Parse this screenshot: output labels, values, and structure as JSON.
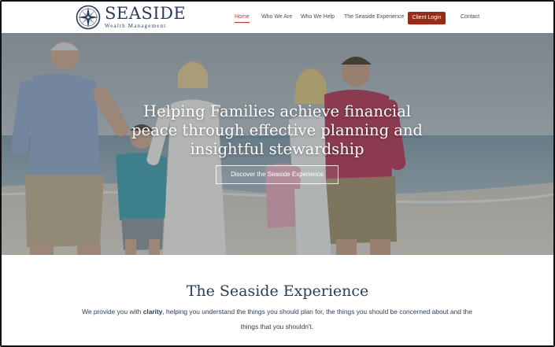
{
  "brand": {
    "name": "SEASIDE",
    "tagline": "Wealth Management",
    "logo_icon": "compass-rose-icon"
  },
  "nav": {
    "items": [
      {
        "label": "Home",
        "active": true
      },
      {
        "label": "Who We Are",
        "active": false
      },
      {
        "label": "Who We Help",
        "active": false
      },
      {
        "label": "The Seaside Experience",
        "active": false
      }
    ],
    "login_label": "Client Login",
    "contact_label": "Contact"
  },
  "hero": {
    "headline_line1": "Helping Families achieve financial",
    "headline_line2": "peace through effective planning and",
    "headline_line3": "insightful stewardship",
    "cta_label": "Discover the Seaside Experience"
  },
  "section": {
    "title": "The Seaside Experience",
    "body_pre": "We provide you with ",
    "body_bold": "clarity",
    "body_post": ", helping you understand the things  you should plan for, the things you should be concerned about and the things that you shouldn't."
  },
  "colors": {
    "brand_navy": "#2a3e5c",
    "accent_red": "#c0392b",
    "login_button": "#9b2a15"
  }
}
